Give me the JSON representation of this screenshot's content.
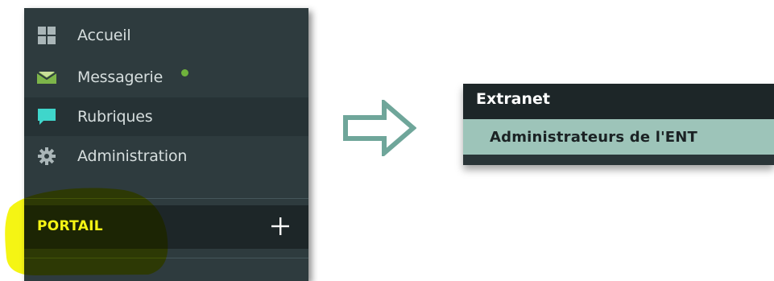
{
  "sidebar": {
    "items": [
      {
        "label": "Accueil",
        "icon": "dashboard-grid-icon"
      },
      {
        "label": "Messagerie",
        "icon": "envelope-icon",
        "unread_indicator": true,
        "unread_color": "#6fb23c"
      },
      {
        "label": "Rubriques",
        "icon": "chat-bubble-icon",
        "active": true
      },
      {
        "label": "Administration",
        "icon": "gear-icon"
      }
    ],
    "portal": {
      "label": "PORTAIL",
      "add_icon": "plus-icon"
    }
  },
  "annotation": {
    "highlight_color": "#f4f400",
    "arrow_color": "#6fa69a"
  },
  "group_panel": {
    "title": "Extranet",
    "selected_item": "Administrateurs de l'ENT",
    "selected_bg": "#9dc4b9"
  },
  "colors": {
    "sidebar_bg": "#2e3b3e",
    "header_bg": "#1d2628"
  }
}
